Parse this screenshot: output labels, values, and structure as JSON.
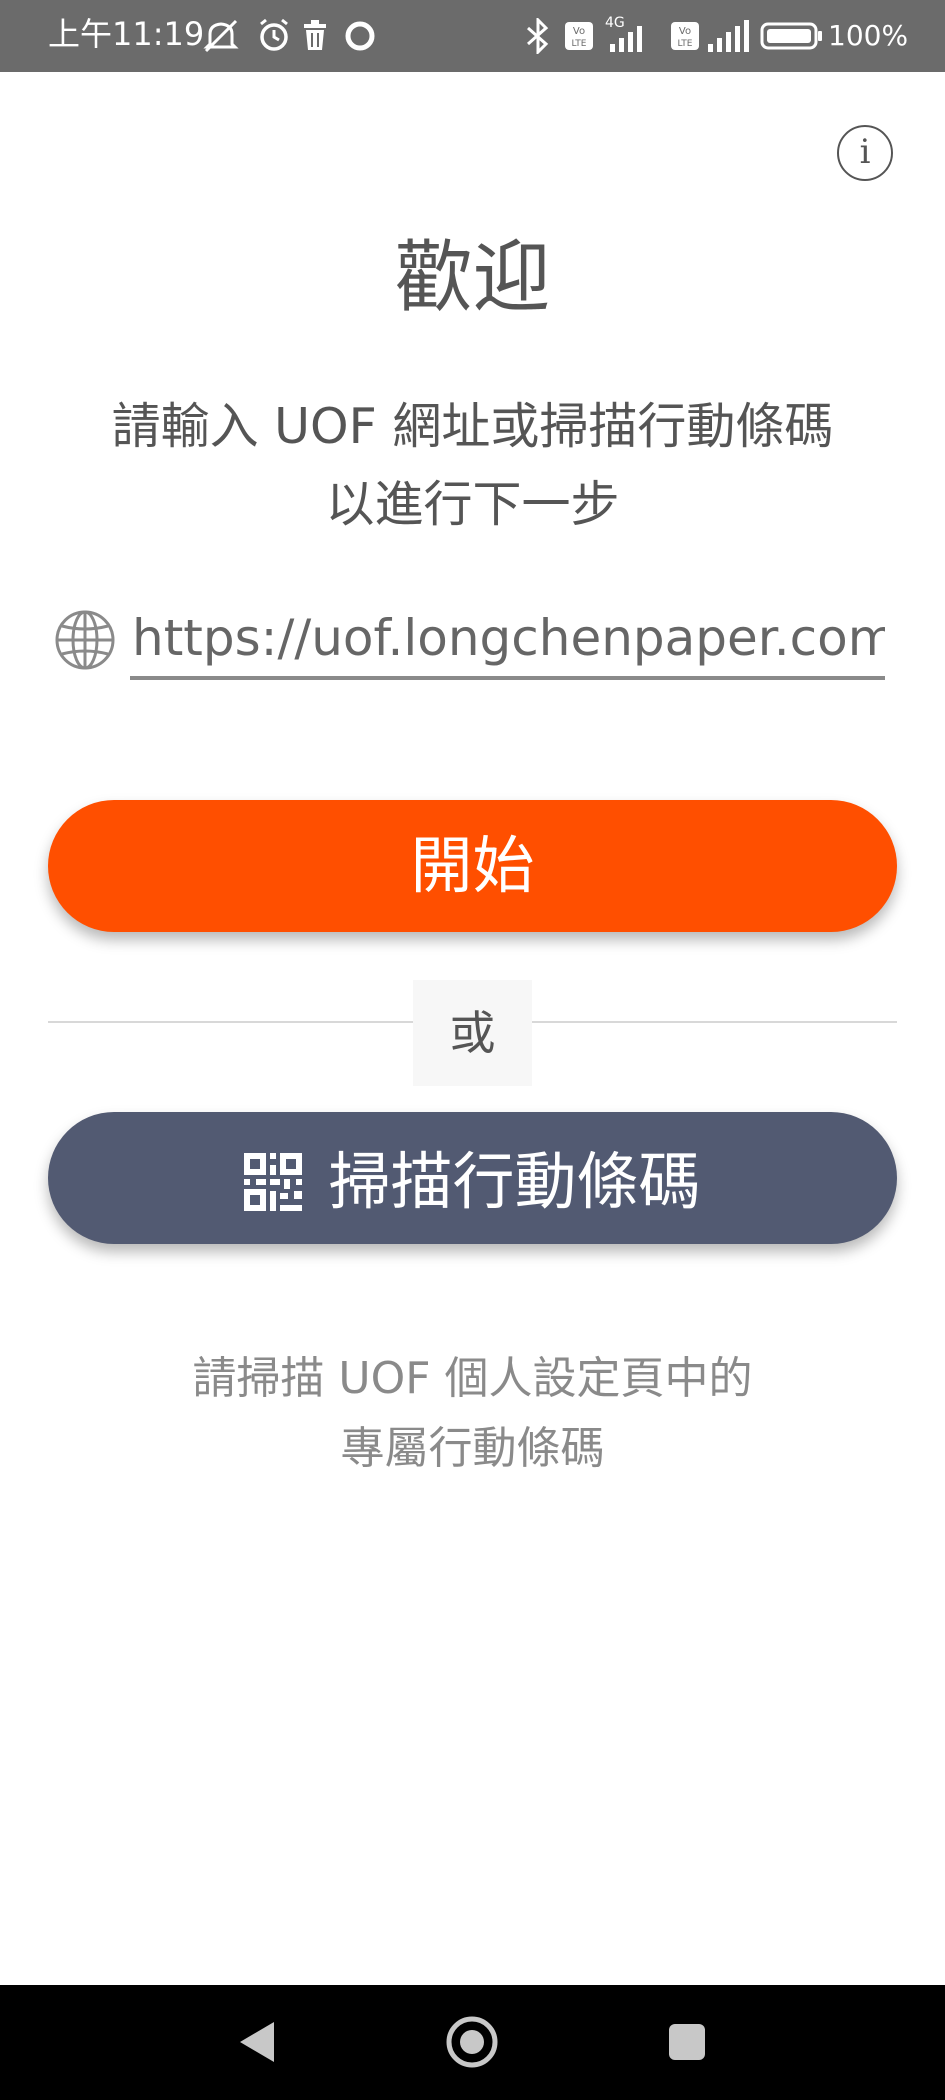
{
  "status_bar": {
    "time": "上午11:19",
    "battery": "100%",
    "icons": [
      "mute-icon",
      "alarm-icon",
      "trash-icon",
      "circle-icon",
      "bluetooth-icon",
      "volte-icon",
      "signal-icon",
      "battery-icon"
    ],
    "network": "4G",
    "volte_label": "Vo LTE"
  },
  "header": {
    "info_label": "i",
    "title": "歡迎",
    "prompt_line1": "請輸入 UOF 網址或掃描行動條碼",
    "prompt_line2": "以進行下一步"
  },
  "url_field": {
    "value": "https://uof.longchenpaper.com/",
    "icon": "globe-icon"
  },
  "actions": {
    "start_label": "開始",
    "or_label": "或",
    "scan_label": "掃描行動條碼",
    "scan_icon": "qr-code-icon"
  },
  "hint": {
    "line1": "請掃描 UOF 個人設定頁中的",
    "line2": "專屬行動條碼"
  },
  "navbar": {
    "buttons": [
      "back-icon",
      "home-icon",
      "recents-icon"
    ]
  },
  "colors": {
    "accent": "#ff4f00",
    "secondary": "#525a72",
    "status_bar": "#6b6b6b",
    "nav_bar": "#000000"
  }
}
